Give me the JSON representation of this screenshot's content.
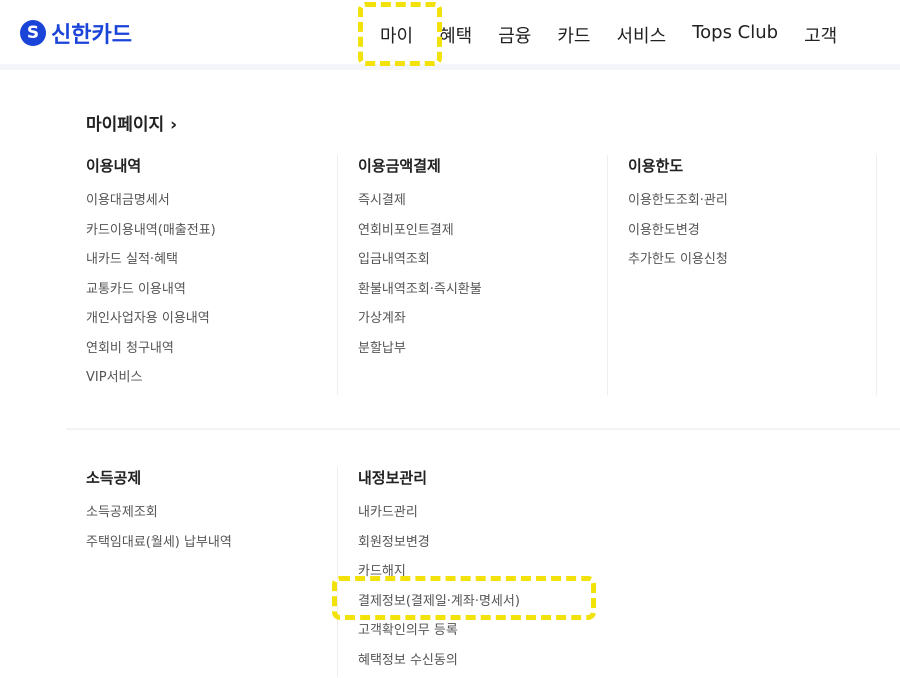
{
  "header": {
    "logo_text": "신한카드",
    "nav": [
      "마이",
      "혜택",
      "금융",
      "카드",
      "서비스",
      "Tops Club",
      "고객"
    ]
  },
  "mypage_link": "마이페이지",
  "sections": [
    {
      "title": "이용내역",
      "items": [
        "이용대금명세서",
        "카드이용내역(매출전표)",
        "내카드 실적·혜택",
        "교통카드 이용내역",
        "개인사업자용 이용내역",
        "연회비 청구내역",
        "VIP서비스"
      ]
    },
    {
      "title": "이용금액결제",
      "items": [
        "즉시결제",
        "연회비포인트결제",
        "입금내역조회",
        "환불내역조회·즉시환불",
        "가상계좌",
        "분할납부"
      ]
    },
    {
      "title": "이용한도",
      "items": [
        "이용한도조회·관리",
        "이용한도변경",
        "추가한도 이용신청"
      ]
    },
    {
      "title": "소득공제",
      "items": [
        "소득공제조회",
        "주택임대료(월세) 납부내역"
      ]
    },
    {
      "title": "내정보관리",
      "items": [
        "내카드관리",
        "회원정보변경",
        "카드해지",
        "결제정보(결제일·계좌·명세서)",
        "고객확인의무 등록",
        "혜택정보 수신동의"
      ]
    }
  ],
  "colors": {
    "brand": "#1a44d8",
    "highlight": "#f2e20a"
  }
}
